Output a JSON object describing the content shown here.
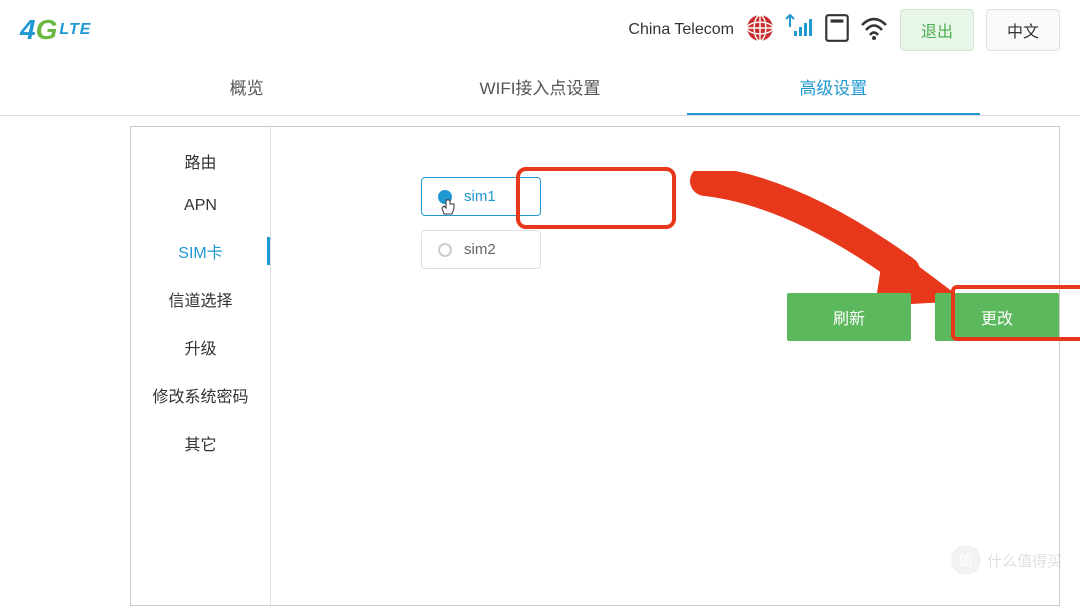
{
  "header": {
    "logo_4": "4",
    "logo_g": "G",
    "logo_lte": "LTE",
    "carrier": "China Telecom",
    "logout_label": "退出",
    "language_label": "中文"
  },
  "tabs": {
    "overview": "概览",
    "wifi": "WIFI接入点设置",
    "advanced": "高级设置"
  },
  "sidebar": {
    "route": "路由",
    "apn": "APN",
    "sim": "SIM卡",
    "channel": "信道选择",
    "upgrade": "升级",
    "password": "修改系统密码",
    "other": "其它"
  },
  "sim_options": {
    "sim1": "sim1",
    "sim2": "sim2"
  },
  "buttons": {
    "refresh": "刷新",
    "change": "更改"
  },
  "watermark": {
    "icon": "值",
    "text": "什么值得买"
  }
}
